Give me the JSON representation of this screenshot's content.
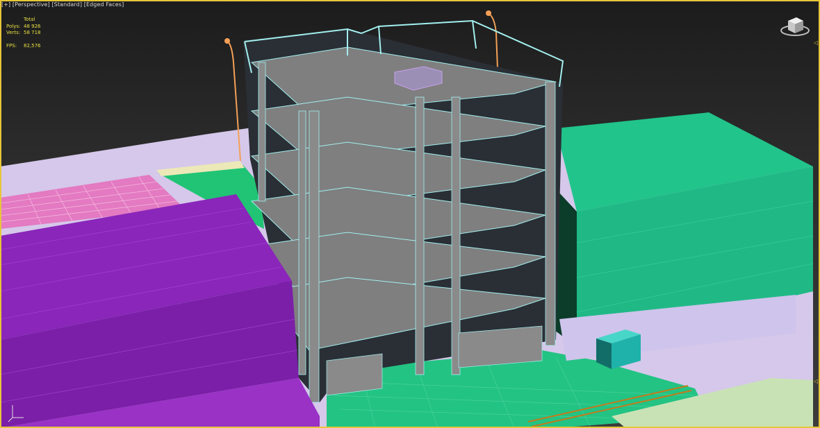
{
  "viewport": {
    "menu_plus": "[+]",
    "view": "[Perspective]",
    "shading": "[Standard]",
    "display": "[Edged Faces]"
  },
  "stats": {
    "header": "Total",
    "polys_label": "Polys:",
    "polys_value": "48 926",
    "verts_label": "Verts:",
    "verts_value": "58 718",
    "fps_label": "FPS:",
    "fps_value": "82,576"
  },
  "colors": {
    "frame": "#e6c63a",
    "structure": "#8a8a8a",
    "edges": "#9ee8e8",
    "purple_building": "#7b1fa8",
    "green_building": "#1fc48a",
    "lavender": "#d8c8ee",
    "pink": "#e879c0"
  },
  "icons": {
    "viewcube": "viewcube-icon",
    "axis": "axis-tripod-icon"
  }
}
